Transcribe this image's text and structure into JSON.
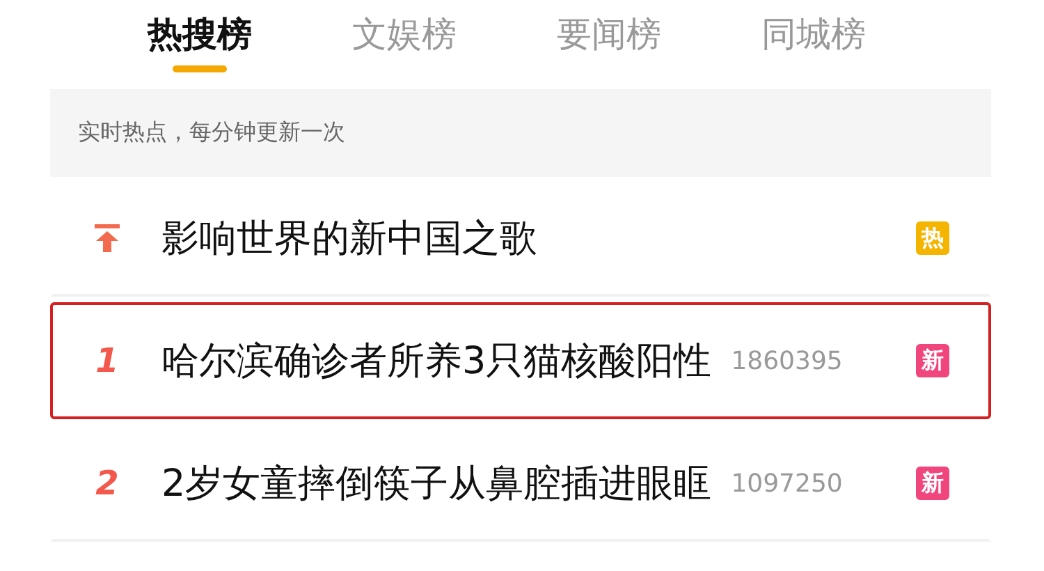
{
  "tabs": [
    {
      "label": "热搜榜",
      "selected": true
    },
    {
      "label": "文娱榜",
      "selected": false
    },
    {
      "label": "要闻榜",
      "selected": false
    },
    {
      "label": "同城榜",
      "selected": false
    }
  ],
  "notice": "实时热点，每分钟更新一次",
  "items": [
    {
      "kind": "pinned",
      "title": "影响世界的新中国之歌",
      "badge": "热",
      "color": "#f5b400",
      "selected": false
    },
    {
      "kind": "ranked",
      "rank": "1",
      "title": "哈尔滨确诊者所养3只猫核酸阳性",
      "count": "1860395",
      "badge": "新",
      "color": "#f0457d",
      "selected": true
    },
    {
      "kind": "ranked",
      "rank": "2",
      "title": "2岁女童摔倒筷子从鼻腔插进眼眶",
      "count": "1097250",
      "badge": "新",
      "color": "#f0457d",
      "selected": false
    }
  ]
}
